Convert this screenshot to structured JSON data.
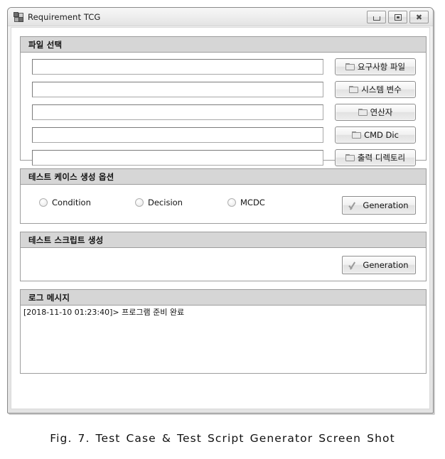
{
  "window": {
    "title": "Requirement TCG",
    "icon": "form-icon",
    "buttons": {
      "minimize": "minimize-icon",
      "maximize": "maximize-icon",
      "close": "close-icon"
    }
  },
  "file_selection": {
    "header": "파일 선택",
    "rows": [
      {
        "value": "",
        "placeholder": "",
        "button_label": "요구사항 파일"
      },
      {
        "value": "",
        "placeholder": "",
        "button_label": "시스템 변수"
      },
      {
        "value": "",
        "placeholder": "",
        "button_label": "연산자"
      },
      {
        "value": "",
        "placeholder": "",
        "button_label": "CMD Dic"
      },
      {
        "value": "",
        "placeholder": "",
        "button_label": "출력 디렉토리"
      }
    ]
  },
  "testcase_options": {
    "header": "테스트 케이스 생성 옵션",
    "radios": [
      {
        "label": "Condition",
        "selected": false
      },
      {
        "label": "Decision",
        "selected": false
      },
      {
        "label": "MCDC",
        "selected": false
      }
    ],
    "generate_label": "Generation"
  },
  "script_generation": {
    "header": "테스트 스크립트 생성",
    "generate_label": "Generation"
  },
  "log": {
    "header": "로그 메시지",
    "lines": [
      "[2018-11-10 01:23:40]> 프로그램 준비 완료"
    ]
  },
  "caption": "Fig. 7. Test Case & Test Script Generator Screen Shot",
  "colors": {
    "group_header_bg": "#d6d6d6",
    "group_border": "#9d9d9d",
    "window_bg": "#ebebeb",
    "client_bg": "#ffffff",
    "text": "#111111",
    "check_icon": "#9a9a9a"
  }
}
